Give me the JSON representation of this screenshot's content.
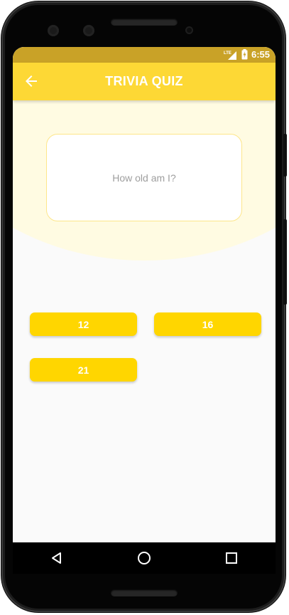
{
  "status_bar": {
    "network_label": "LTE",
    "time": "6:55",
    "icons": [
      "signal-icon",
      "battery-charging-icon"
    ]
  },
  "app_bar": {
    "title": "TRIVIA QUIZ",
    "back_icon": "arrow-left-icon"
  },
  "question": {
    "text": "How old am I?"
  },
  "answers": [
    {
      "label": "12"
    },
    {
      "label": "16"
    },
    {
      "label": "21"
    }
  ],
  "nav_bar": {
    "icons": [
      "back-triangle-icon",
      "home-circle-icon",
      "recents-square-icon"
    ]
  },
  "colors": {
    "status_bar": "#c9a227",
    "app_bar": "#fdd835",
    "accent": "#ffd600",
    "background_curve": "#fffbe2",
    "screen_bg": "#fafafa"
  }
}
